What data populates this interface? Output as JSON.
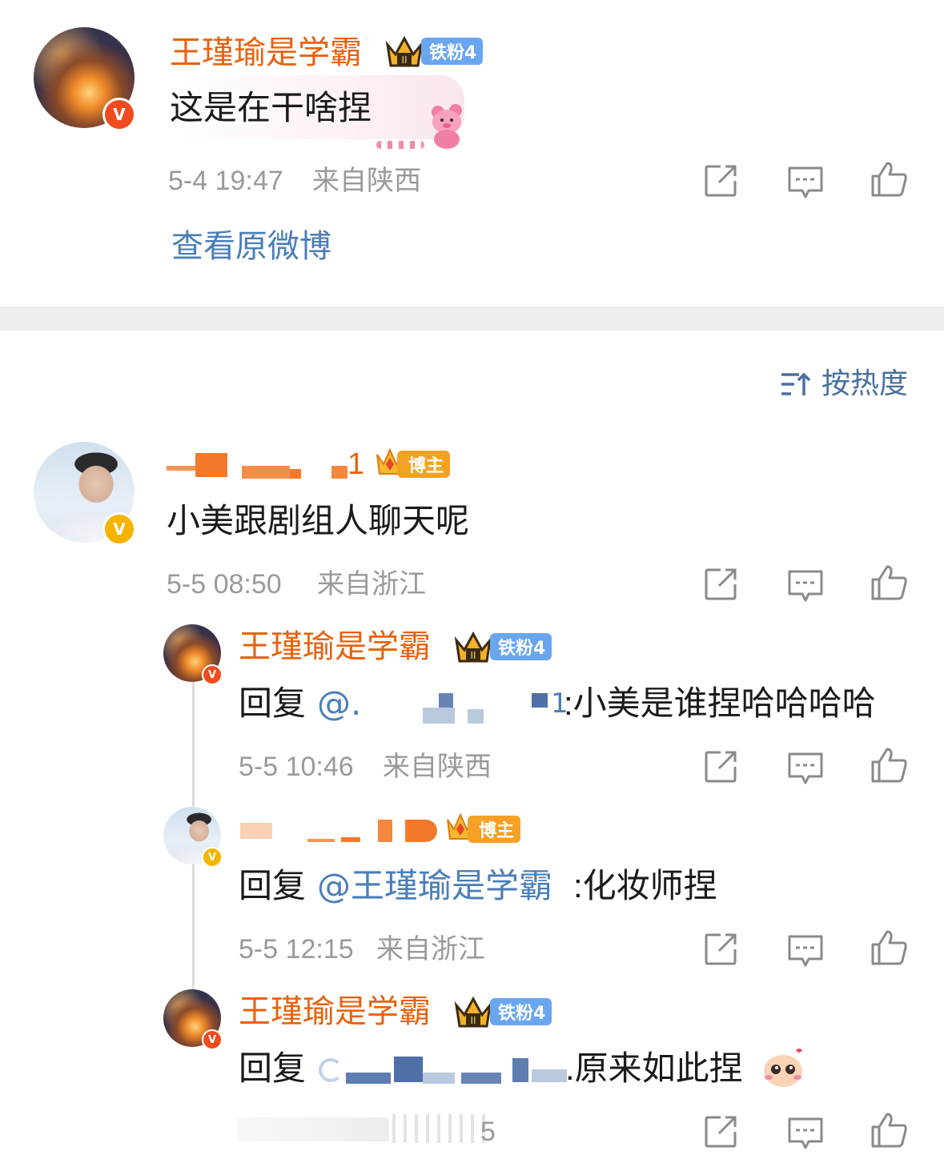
{
  "comment1": {
    "username": "王瑾瑜是学霸",
    "fan_badge": "铁粉4",
    "text": "这是在干啥捏",
    "time": "5-4 19:47",
    "location": "来自陕西",
    "view_original": "查看原微博"
  },
  "sort": {
    "label": "按热度",
    "icon": "sort-icon"
  },
  "comment2": {
    "username_tail": "1",
    "owner_badge": "博主",
    "text": "小美跟剧组人聊天呢",
    "time": "5-5 08:50",
    "location": "来自浙江"
  },
  "reply1": {
    "username": "王瑾瑜是学霸",
    "fan_badge": "铁粉4",
    "prefix": "回复",
    "mention_start": "@.",
    "mention_tail": "1",
    "body": ":小美是谁捏哈哈哈哈",
    "time": "5-5 10:46",
    "location": "来自陕西"
  },
  "reply2": {
    "owner_badge": "博主",
    "prefix": "回复",
    "mention": "@王瑾瑜是学霸",
    "body": ":化妆师捏",
    "time": "5-5 12:15",
    "location": "来自浙江"
  },
  "reply3": {
    "username": "王瑾瑜是学霸",
    "fan_badge": "铁粉4",
    "prefix": "回复",
    "body": ".原来如此捏",
    "time_tail": "5"
  },
  "colors": {
    "username": "#e8620e",
    "link": "#4a7eb8",
    "meta": "#9a9a9a",
    "fan_badge": "#6aa6f0",
    "owner_badge": "#f6a125"
  }
}
